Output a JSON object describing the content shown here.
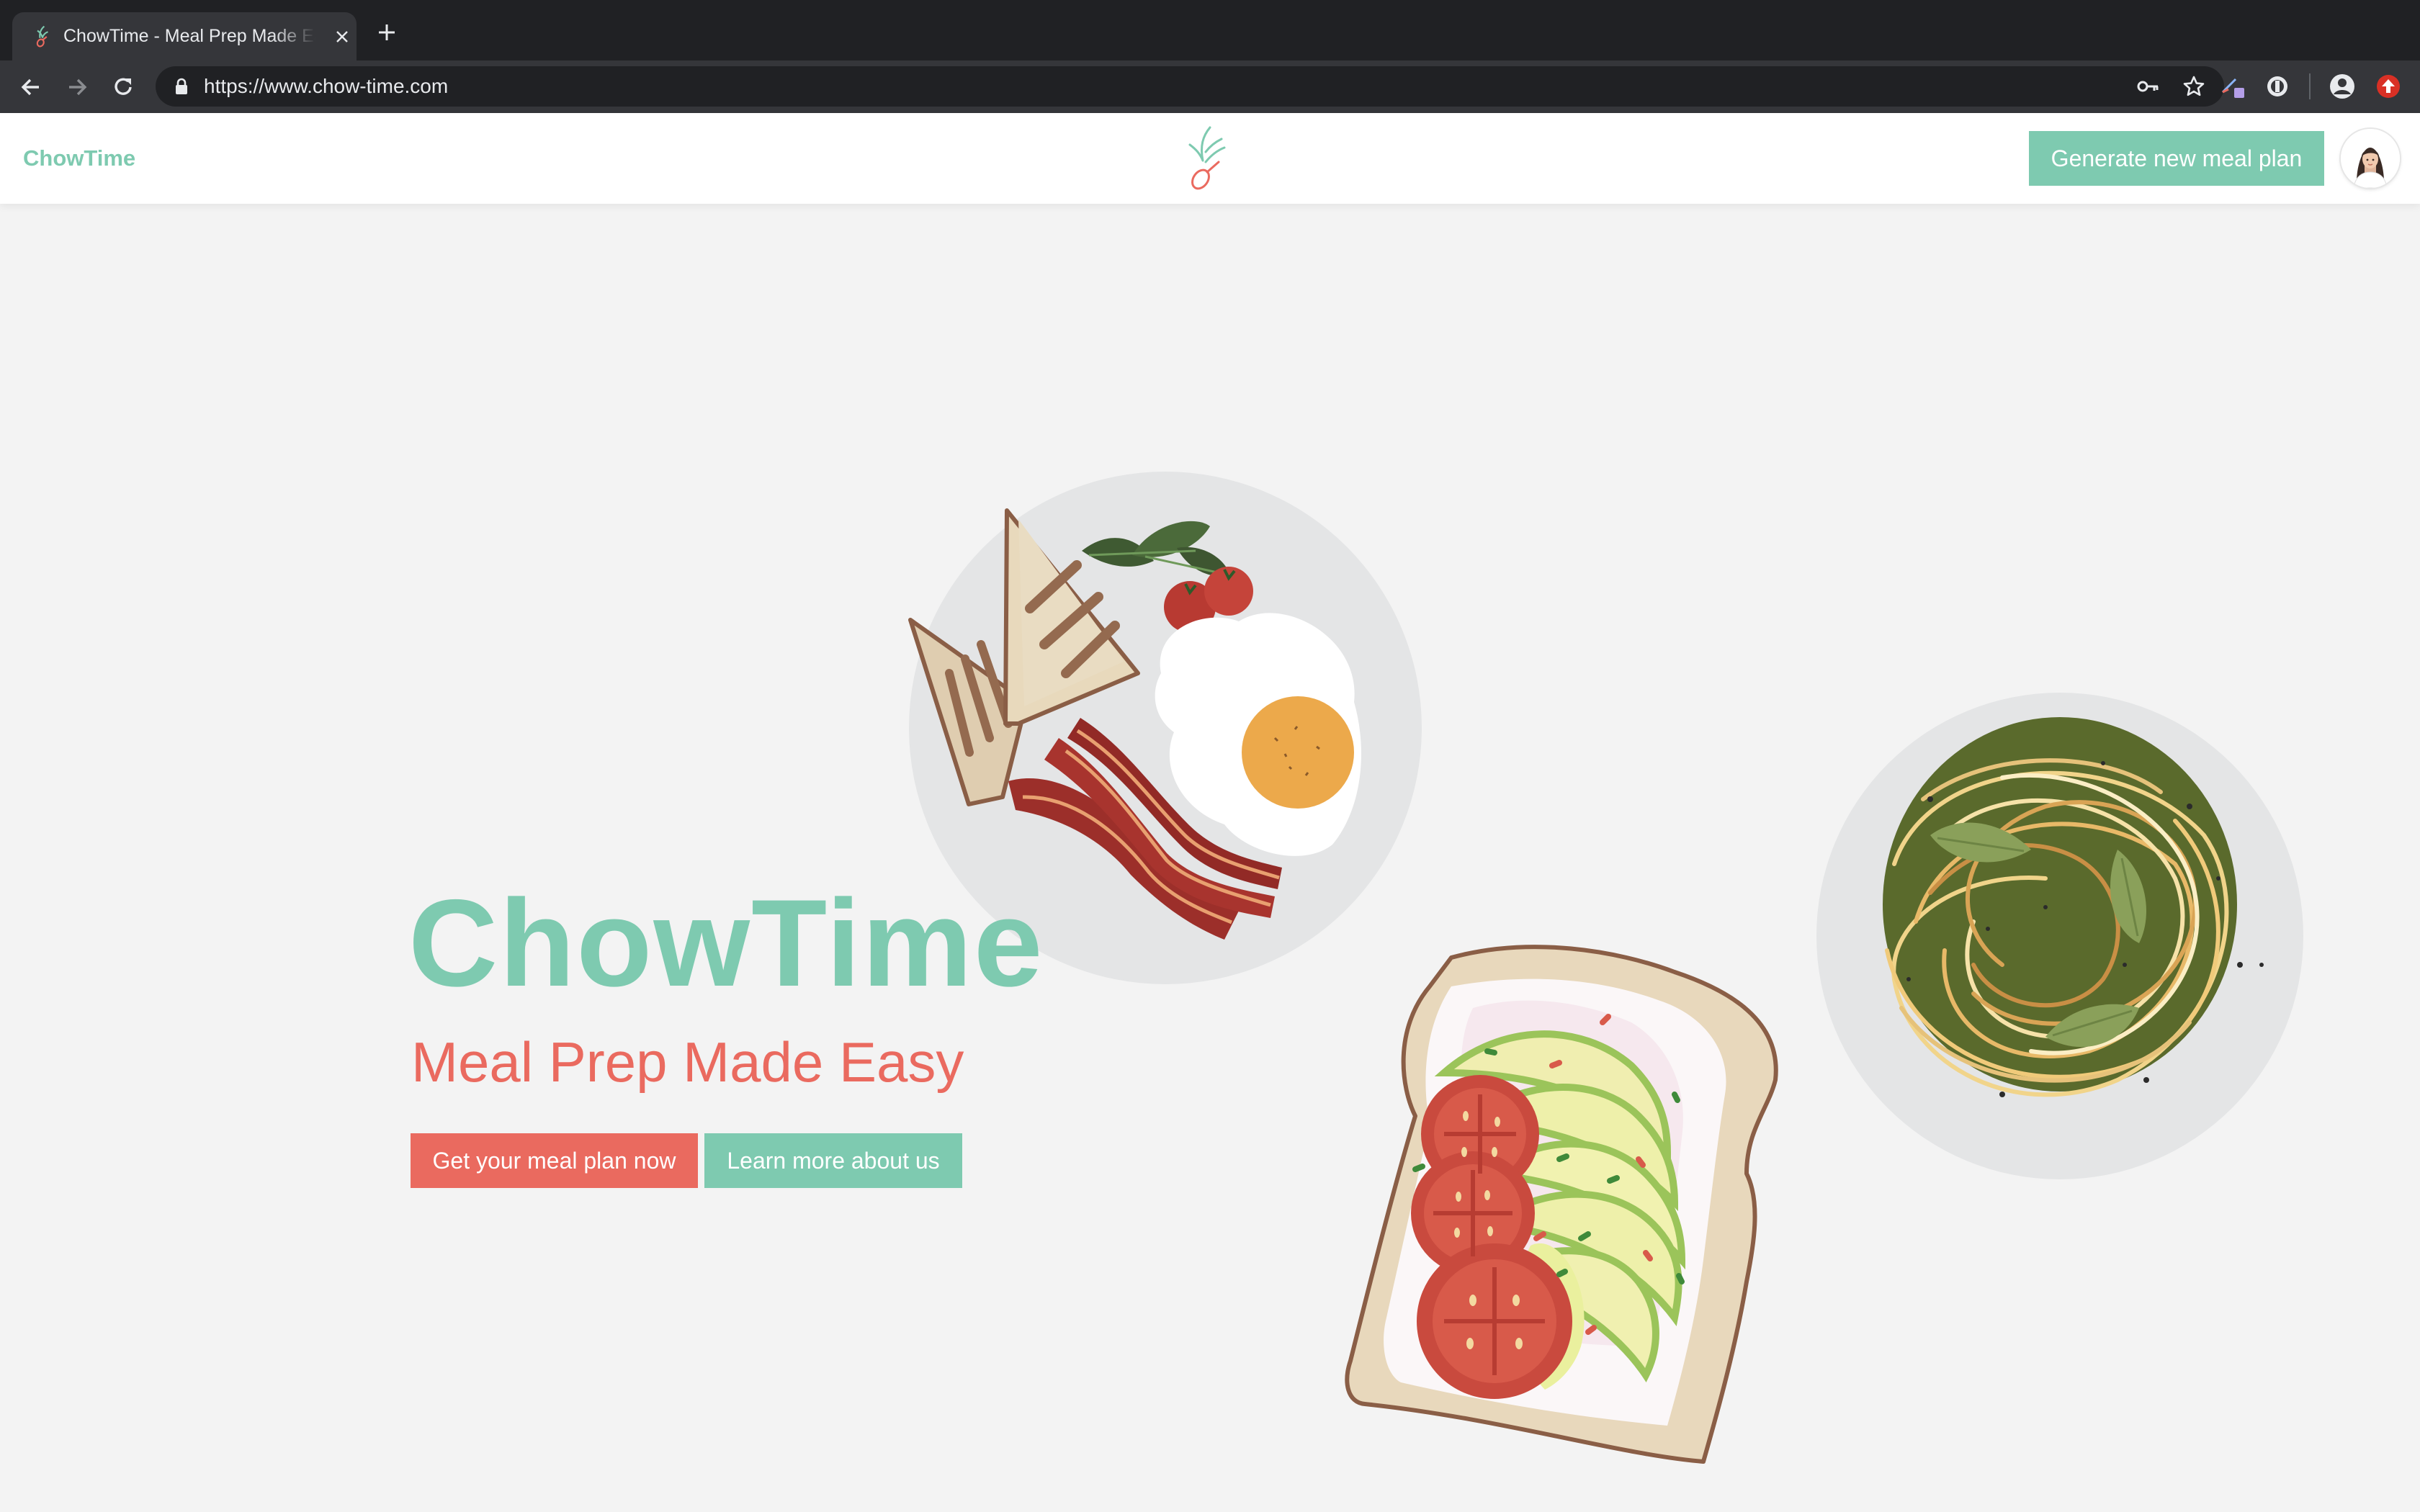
{
  "browser": {
    "tab_title": "ChowTime - Meal Prep Made Easy",
    "url": "https://www.chow-time.com"
  },
  "header": {
    "brand": "ChowTime",
    "generate_button": "Generate new meal plan"
  },
  "hero": {
    "title": "ChowTime",
    "subtitle": "Meal Prep Made Easy",
    "primary_cta": "Get your meal plan now",
    "secondary_cta": "Learn more about us"
  },
  "colors": {
    "brand_green": "#7ecab0",
    "brand_coral": "#ea6a5f",
    "background": "#f3f3f3"
  },
  "icons": [
    "chowtime-favicon",
    "close-icon",
    "plus-icon",
    "back-arrow-icon",
    "forward-arrow-icon",
    "reload-icon",
    "lock-icon",
    "key-icon",
    "star-icon",
    "extension-icon",
    "account-icon",
    "update-icon"
  ]
}
